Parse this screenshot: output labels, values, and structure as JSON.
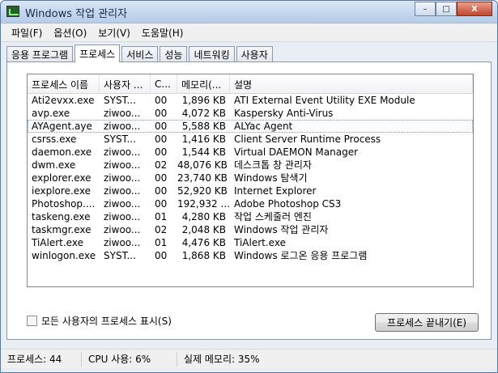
{
  "window": {
    "title": "Windows 작업 관리자"
  },
  "titlebar": {
    "minimize": "–",
    "maximize": "□",
    "close": "X"
  },
  "menu": [
    "파일(F)",
    "옵션(O)",
    "보기(V)",
    "도움말(H)"
  ],
  "tabs": [
    "응용 프로그램",
    "프로세스",
    "서비스",
    "성능",
    "네트워킹",
    "사용자"
  ],
  "active_tab": "프로세스",
  "columns": [
    "프로세스 이름",
    "사용자 ...",
    "C...",
    "메모리(...",
    "설명"
  ],
  "processes": [
    {
      "name": "Ati2evxx.exe",
      "user": "SYST...",
      "cpu": "00",
      "mem": "1,896 KB",
      "desc": "ATI External Event Utility EXE Module"
    },
    {
      "name": "avp.exe",
      "user": "ziwoo...",
      "cpu": "00",
      "mem": "4,072 KB",
      "desc": "Kaspersky Anti-Virus"
    },
    {
      "name": "AYAgent.aye",
      "user": "ziwoo...",
      "cpu": "00",
      "mem": "5,588 KB",
      "desc": "ALYac Agent"
    },
    {
      "name": "csrss.exe",
      "user": "SYST...",
      "cpu": "00",
      "mem": "1,416 KB",
      "desc": "Client Server Runtime Process"
    },
    {
      "name": "daemon.exe",
      "user": "ziwoo...",
      "cpu": "00",
      "mem": "1,544 KB",
      "desc": "Virtual DAEMON Manager"
    },
    {
      "name": "dwm.exe",
      "user": "ziwoo...",
      "cpu": "02",
      "mem": "48,076 KB",
      "desc": "데스크톱 창 관리자"
    },
    {
      "name": "explorer.exe",
      "user": "ziwoo...",
      "cpu": "00",
      "mem": "23,740 KB",
      "desc": "Windows 탐색기"
    },
    {
      "name": "iexplore.exe",
      "user": "ziwoo...",
      "cpu": "00",
      "mem": "52,920 KB",
      "desc": "Internet Explorer"
    },
    {
      "name": "Photoshop....",
      "user": "ziwoo...",
      "cpu": "00",
      "mem": "192,932 ...",
      "desc": "Adobe Photoshop CS3"
    },
    {
      "name": "taskeng.exe",
      "user": "ziwoo...",
      "cpu": "01",
      "mem": "4,280 KB",
      "desc": "작업 스케줄러 엔진"
    },
    {
      "name": "taskmgr.exe",
      "user": "ziwoo...",
      "cpu": "02",
      "mem": "2,048 KB",
      "desc": "Windows 작업 관리자"
    },
    {
      "name": "TiAlert.exe",
      "user": "ziwoo...",
      "cpu": "01",
      "mem": "4,476 KB",
      "desc": "TiAlert.exe"
    },
    {
      "name": "winlogon.exe",
      "user": "SYST...",
      "cpu": "00",
      "mem": "1,868 KB",
      "desc": "Windows 로그온 응용 프로그램"
    }
  ],
  "selected_process": "AYAgent.aye",
  "show_all_label": "모든 사용자의 프로세스 표시(S)",
  "end_process_label": "프로세스 끝내기(E)",
  "status": {
    "processes": "프로세스: 44",
    "cpu": "CPU 사용: 6%",
    "memory": "실제 메모리: 35%"
  }
}
